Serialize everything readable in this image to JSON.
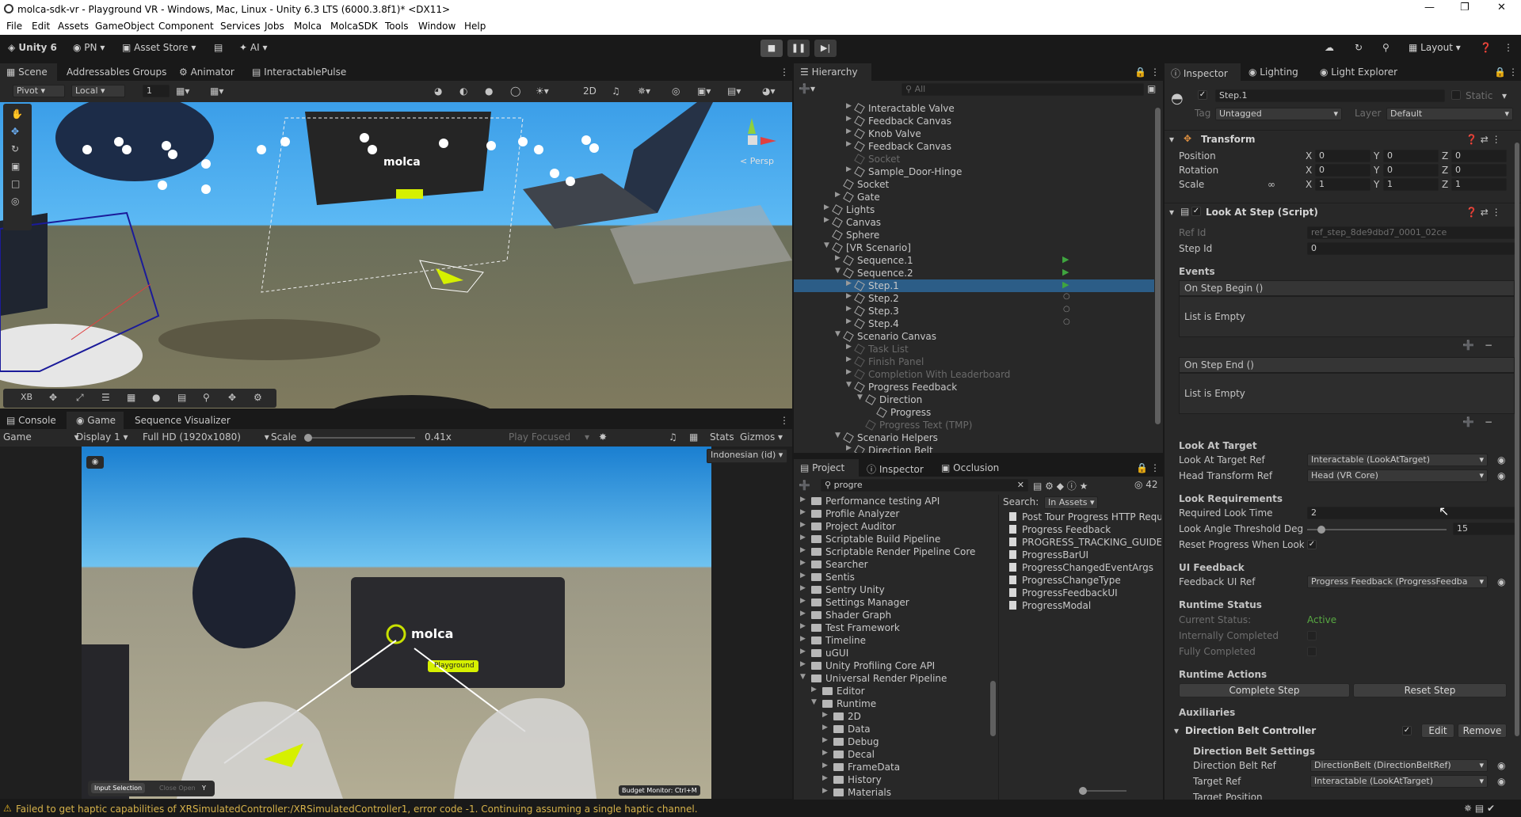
{
  "window": {
    "title": "molca-sdk-vr - Playground VR - Windows, Mac, Linux - Unity 6.3 LTS (6000.3.8f1)* <DX11>"
  },
  "menu": [
    "File",
    "Edit",
    "Assets",
    "GameObject",
    "Component",
    "Services",
    "Jobs",
    "Molca",
    "MolcaSDK",
    "Tools",
    "Window",
    "Help"
  ],
  "toolbar": {
    "account": "Unity 6",
    "user": "PN",
    "asset_store": "Asset Store",
    "ai": "AI",
    "layout": "Layout"
  },
  "scene_tabs": [
    "Scene",
    "Addressables Groups",
    "Animator",
    "InteractablePulse"
  ],
  "scene_toolbar": {
    "pivot": "Pivot",
    "local": "Local",
    "snap": "1",
    "mode2d": "2D"
  },
  "scene_overlay": {
    "persp": "< Persp",
    "sign": "molca"
  },
  "game_tabs": [
    "Console",
    "Game",
    "Sequence Visualizer"
  ],
  "game_toolbar": {
    "game": "Game",
    "display": "Display 1",
    "resolution": "Full HD (1920x1080)",
    "scale_label": "Scale",
    "scale_value": "0.41x",
    "play_focused": "Play Focused",
    "stats": "Stats",
    "gizmos": "Gizmos",
    "language": "Indonesian (id)"
  },
  "game_overlay": {
    "sign": "molca",
    "sign_tag": "Playground",
    "input": "Input Selection",
    "close": "Close Open",
    "close_key": "Y",
    "budget": "Budget Monitor: Ctrl+M"
  },
  "hierarchy": {
    "title": "Hierarchy",
    "search_placeholder": "All",
    "rows": [
      {
        "label": "Interactable Valve",
        "indent": 5,
        "dim": false,
        "arrow": true
      },
      {
        "label": "Feedback Canvas",
        "indent": 5,
        "dim": false,
        "arrow": true
      },
      {
        "label": "Knob Valve",
        "indent": 5,
        "dim": false,
        "arrow": true
      },
      {
        "label": "Feedback Canvas",
        "indent": 5,
        "dim": false,
        "arrow": true
      },
      {
        "label": "Socket",
        "indent": 5,
        "dim": true,
        "arrow": false
      },
      {
        "label": "Sample_Door-Hinge",
        "indent": 5,
        "dim": false,
        "arrow": true
      },
      {
        "label": "Socket",
        "indent": 4,
        "dim": false,
        "arrow": false
      },
      {
        "label": "Gate",
        "indent": 4,
        "dim": false,
        "arrow": true
      },
      {
        "label": "Lights",
        "indent": 3,
        "dim": false,
        "arrow": true
      },
      {
        "label": "Canvas",
        "indent": 3,
        "dim": false,
        "arrow": true
      },
      {
        "label": "Sphere",
        "indent": 3,
        "dim": false,
        "arrow": false
      },
      {
        "label": "[VR Scenario]",
        "indent": 3,
        "dim": false,
        "arrow": true,
        "open": true
      },
      {
        "label": "Sequence.1",
        "indent": 4,
        "dim": false,
        "arrow": true,
        "play": true
      },
      {
        "label": "Sequence.2",
        "indent": 4,
        "dim": false,
        "arrow": true,
        "open": true,
        "play": true
      },
      {
        "label": "Step.1",
        "indent": 5,
        "dim": false,
        "arrow": true,
        "selected": true,
        "play": true
      },
      {
        "label": "Step.2",
        "indent": 5,
        "dim": false,
        "arrow": true,
        "circle": true
      },
      {
        "label": "Step.3",
        "indent": 5,
        "dim": false,
        "arrow": true,
        "circle": true
      },
      {
        "label": "Step.4",
        "indent": 5,
        "dim": false,
        "arrow": true,
        "circle": true
      },
      {
        "label": "Scenario Canvas",
        "indent": 4,
        "dim": false,
        "arrow": true,
        "open": true
      },
      {
        "label": "Task List",
        "indent": 5,
        "dim": true,
        "arrow": true
      },
      {
        "label": "Finish Panel",
        "indent": 5,
        "dim": true,
        "arrow": true
      },
      {
        "label": "Completion With Leaderboard",
        "indent": 5,
        "dim": true,
        "arrow": true
      },
      {
        "label": "Progress Feedback",
        "indent": 5,
        "dim": false,
        "arrow": true,
        "open": true
      },
      {
        "label": "Direction",
        "indent": 6,
        "dim": false,
        "arrow": true,
        "open": true
      },
      {
        "label": "Progress",
        "indent": 7,
        "dim": false,
        "arrow": false
      },
      {
        "label": "Progress Text (TMP)",
        "indent": 6,
        "dim": true,
        "arrow": false
      },
      {
        "label": "Scenario Helpers",
        "indent": 4,
        "dim": false,
        "arrow": true,
        "open": true
      },
      {
        "label": "Direction Belt",
        "indent": 5,
        "dim": false,
        "arrow": true
      }
    ]
  },
  "project": {
    "tabs": [
      "Project",
      "Inspector",
      "Occlusion"
    ],
    "search_value": "progre",
    "count": "42",
    "search_label": "Search:",
    "search_scope": "In Assets",
    "folders": [
      {
        "label": "Performance testing API",
        "indent": 0
      },
      {
        "label": "Profile Analyzer",
        "indent": 0
      },
      {
        "label": "Project Auditor",
        "indent": 0
      },
      {
        "label": "Scriptable Build Pipeline",
        "indent": 0
      },
      {
        "label": "Scriptable Render Pipeline Core",
        "indent": 0
      },
      {
        "label": "Searcher",
        "indent": 0
      },
      {
        "label": "Sentis",
        "indent": 0
      },
      {
        "label": "Sentry Unity",
        "indent": 0
      },
      {
        "label": "Settings Manager",
        "indent": 0
      },
      {
        "label": "Shader Graph",
        "indent": 0
      },
      {
        "label": "Test Framework",
        "indent": 0
      },
      {
        "label": "Timeline",
        "indent": 0
      },
      {
        "label": "uGUI",
        "indent": 0
      },
      {
        "label": "Unity Profiling Core API",
        "indent": 0
      },
      {
        "label": "Universal Render Pipeline",
        "indent": 0
      },
      {
        "label": "Editor",
        "indent": 1
      },
      {
        "label": "Runtime",
        "indent": 1
      },
      {
        "label": "2D",
        "indent": 2
      },
      {
        "label": "Data",
        "indent": 2
      },
      {
        "label": "Debug",
        "indent": 2
      },
      {
        "label": "Decal",
        "indent": 2
      },
      {
        "label": "FrameData",
        "indent": 2
      },
      {
        "label": "History",
        "indent": 2
      },
      {
        "label": "Materials",
        "indent": 2
      }
    ],
    "results": [
      "Post Tour Progress HTTP Requ",
      "Progress Feedback",
      "PROGRESS_TRACKING_GUIDE",
      "ProgressBarUI",
      "ProgressChangedEventArgs",
      "ProgressChangeType",
      "ProgressFeedbackUI",
      "ProgressModal"
    ]
  },
  "inspector": {
    "tabs": [
      "Inspector",
      "Lighting",
      "Light Explorer"
    ],
    "object_name": "Step.1",
    "static_label": "Static",
    "tag_label": "Tag",
    "tag_value": "Untagged",
    "layer_label": "Layer",
    "layer_value": "Default",
    "transform": {
      "title": "Transform",
      "rows": [
        {
          "label": "Position",
          "x": "0",
          "y": "0",
          "z": "0"
        },
        {
          "label": "Rotation",
          "x": "0",
          "y": "0",
          "z": "0"
        },
        {
          "label": "Scale",
          "x": "1",
          "y": "1",
          "z": "1"
        }
      ]
    },
    "script": {
      "title": "Look At Step (Script)",
      "ref_id_label": "Ref Id",
      "ref_id": "ref_step_8de9dbd7_0001_02ce",
      "step_id_label": "Step Id",
      "step_id": "0",
      "events_label": "Events",
      "on_begin": "On Step Begin ()",
      "on_end": "On Step End ()",
      "empty": "List is Empty",
      "look_target_hdr": "Look At Target",
      "look_target_ref_label": "Look At Target Ref",
      "look_target_ref": "Interactable (LookAtTarget)",
      "head_ref_label": "Head Transform Ref",
      "head_ref": "Head (VR Core)",
      "look_req_hdr": "Look Requirements",
      "req_time_label": "Required Look Time",
      "req_time": "2",
      "angle_label": "Look Angle Threshold Degre",
      "angle_value": "15",
      "angle_fraction": 0.1,
      "reset_label": "Reset Progress When Look A",
      "ui_fb_hdr": "UI Feedback",
      "fb_ref_label": "Feedback UI Ref",
      "fb_ref": "Progress Feedback (ProgressFeedba",
      "runtime_status_hdr": "Runtime Status",
      "current_status_label": "Current Status:",
      "current_status": "Active",
      "int_completed_label": "Internally Completed",
      "fully_completed_label": "Fully Completed",
      "runtime_actions_hdr": "Runtime Actions",
      "complete_btn": "Complete Step",
      "reset_btn": "Reset Step",
      "aux_hdr": "Auxiliaries",
      "belt_title": "Direction Belt Controller",
      "edit_btn": "Edit",
      "remove_btn": "Remove",
      "belt_settings_hdr": "Direction Belt Settings",
      "belt_ref_label": "Direction Belt Ref",
      "belt_ref": "DirectionBelt (DirectionBeltRef)",
      "target_ref_label": "Target Ref",
      "target_ref": "Interactable (LookAtTarget)",
      "target_pos_label": "Target Position"
    }
  },
  "status": {
    "message": "Failed to get haptic capabilities of XRSimulatedController:/XRSimulatedController1, error code -1. Continuing assuming a single haptic channel."
  },
  "colors": {
    "accent": "#2c5d87",
    "play_green": "#3fa53f",
    "status_active": "#58a942",
    "warning": "#e6b422"
  }
}
